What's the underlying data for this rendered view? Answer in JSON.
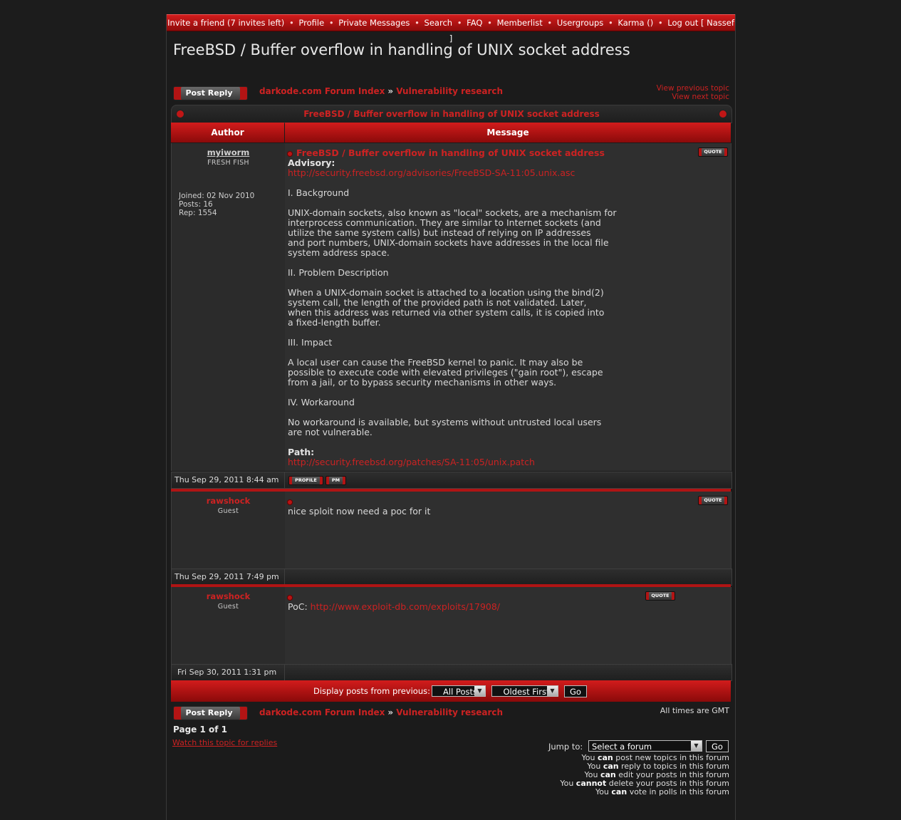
{
  "nav": {
    "items": [
      "Invite a friend (7 invites left)",
      "Profile",
      "Private Messages",
      "Search",
      "FAQ",
      "Memberlist",
      "Usergroups",
      "Karma ()",
      "Log out [ Nassef ]"
    ],
    "separator": "•"
  },
  "topic_title": "FreeBSD / Buffer overflow in handling of UNIX socket address",
  "post_reply_label": "Post Reply",
  "breadcrumb": {
    "forum_index": "darkode.com Forum Index",
    "separator": "»",
    "forum": "Vulnerability research"
  },
  "topic_nav": {
    "prev": "View previous topic",
    "next": "View next topic"
  },
  "columns": {
    "author": "Author",
    "message": "Message"
  },
  "quote_label": "QUOTE",
  "profile_label": "PROFILE",
  "pm_label": "PM",
  "posts": [
    {
      "author": "myiworm",
      "rank": "FRESH FISH",
      "joined": "Joined: 02 Nov 2010",
      "posts": "Posts: 16",
      "rep": "Rep: 1554",
      "title": "FreeBSD / Buffer overflow in handling of UNIX socket address",
      "advisory_label": "Advisory:",
      "advisory_url": "http://security.freebsd.org/advisories/FreeBSD-SA-11:05.unix.asc",
      "s1_head": "I. Background",
      "s1_body": [
        "UNIX-domain sockets, also known as \"local\" sockets, are a mechanism for",
        "interprocess communication. They are similar to Internet sockets (and",
        "utilize the same system calls) but instead of relying on IP addresses",
        "and port numbers, UNIX-domain sockets have addresses in the local file",
        "system address space."
      ],
      "s2_head": "II. Problem Description",
      "s2_body": [
        "When a UNIX-domain socket is attached to a location using the bind(2)",
        "system call, the length of the provided path is not validated. Later,",
        "when this address was returned via other system calls, it is copied into",
        "a fixed-length buffer."
      ],
      "s3_head": "III. Impact",
      "s3_body": [
        "A local user can cause the FreeBSD kernel to panic. It may also be",
        "possible to execute code with elevated privileges (\"gain root\"), escape",
        "from a jail, or to bypass security mechanisms in other ways."
      ],
      "s4_head": "IV. Workaround",
      "s4_body": [
        "No workaround is available, but systems without untrusted local users",
        "are not vulnerable."
      ],
      "path_label": "Path:",
      "path_url": "http://security.freebsd.org/patches/SA-11:05/unix.patch",
      "date": "Thu Sep 29, 2011 8:44 am"
    },
    {
      "author": "rawshock",
      "rank": "Guest",
      "text": "nice sploit now need a poc for it",
      "date": "Thu Sep 29, 2011 7:49 pm"
    },
    {
      "author": "rawshock",
      "rank": "Guest",
      "text_prefix": "PoC:",
      "link": "http://www.exploit-db.com/exploits/17908/",
      "date": "Fri Sep 30, 2011 1:31 pm"
    }
  ],
  "display": {
    "label": "Display posts from previous:",
    "range": "All Posts",
    "order": "Oldest First",
    "go": "Go"
  },
  "timezone": "All times are GMT",
  "page_info": "Page 1 of 1",
  "watch": "Watch this topic for replies",
  "jump": {
    "label": "Jump to:",
    "select": "Select a forum",
    "go": "Go"
  },
  "permissions": [
    {
      "pre": "You",
      "verb": "can",
      "post": "post new topics in this forum"
    },
    {
      "pre": "You",
      "verb": "can",
      "post": "reply to topics in this forum"
    },
    {
      "pre": "You",
      "verb": "can",
      "post": "edit your posts in this forum"
    },
    {
      "pre": "You",
      "verb": "cannot",
      "post": "delete your posts in this forum"
    },
    {
      "pre": "You",
      "verb": "can",
      "post": "vote in polls in this forum"
    }
  ]
}
